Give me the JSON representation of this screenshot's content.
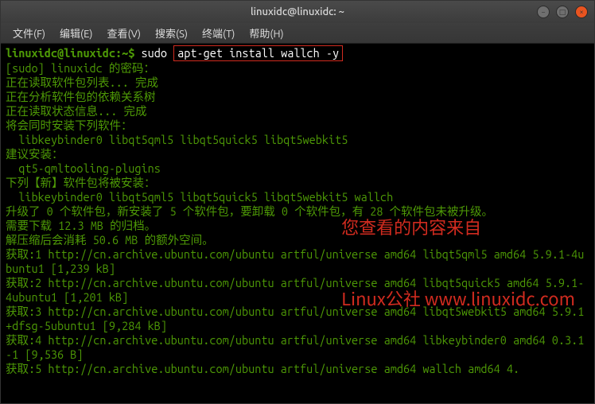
{
  "window": {
    "title": "linuxidc@linuxidc: ~"
  },
  "menubar": {
    "items": [
      "文件(F)",
      "编辑(E)",
      "查看(V)",
      "搜索(S)",
      "终端(T)",
      "帮助(H)"
    ]
  },
  "prompt": {
    "user_host": "linuxidc@linuxidc",
    "path": ":~$",
    "cmd_sudo": "sudo",
    "cmd_highlighted": "apt-get install wallch -y"
  },
  "output": {
    "lines": [
      "[sudo] linuxidc 的密码：",
      "正在读取软件包列表... 完成",
      "正在分析软件包的依赖关系树       ",
      "正在读取状态信息... 完成       ",
      "将会同时安装下列软件：",
      "  libkeybinder0 libqt5qml5 libqt5quick5 libqt5webkit5",
      "建议安装：",
      "  qt5-qmltooling-plugins",
      "下列【新】软件包将被安装：",
      "  libkeybinder0 libqt5qml5 libqt5quick5 libqt5webkit5 wallch",
      "升级了 0 个软件包，新安装了 5 个软件包，要卸载 0 个软件包，有 28 个软件包未被升级。",
      "需要下载 12.3 MB 的归档。",
      "解压缩后会消耗 50.6 MB 的额外空间。",
      "获取:1 http://cn.archive.ubuntu.com/ubuntu artful/universe amd64 libqt5qml5 amd64 5.9.1-4ubuntu1 [1,239 kB]",
      "获取:2 http://cn.archive.ubuntu.com/ubuntu artful/universe amd64 libqt5quick5 amd64 5.9.1-4ubuntu1 [1,201 kB]",
      "获取:3 http://cn.archive.ubuntu.com/ubuntu artful/universe amd64 libqt5webkit5 amd64 5.9.1+dfsg-5ubuntu1 [9,284 kB]",
      "获取:4 http://cn.archive.ubuntu.com/ubuntu artful/universe amd64 libkeybinder0 amd64 0.3.1-1 [9,536 B]",
      "获取:5 http://cn.archive.ubuntu.com/ubuntu artful/universe amd64 wallch amd64 4."
    ]
  },
  "watermark": {
    "line1": "您查看的内容来自",
    "line2": "Linux公社 www.linuxidc.com"
  },
  "controls": {
    "min": "−",
    "max": "□",
    "close": "×"
  }
}
